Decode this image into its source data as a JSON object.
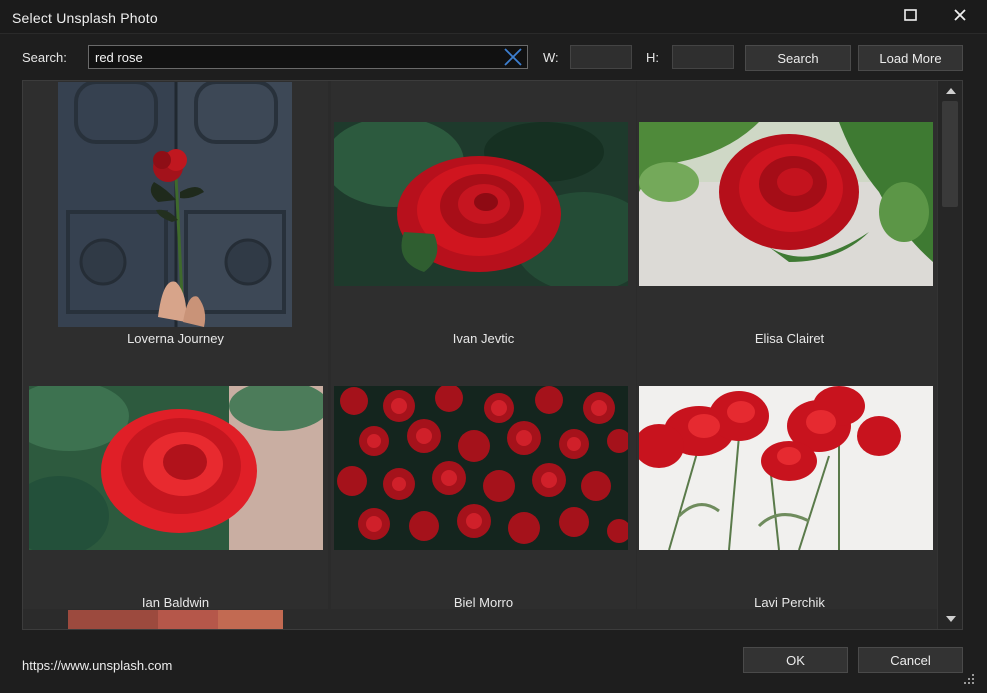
{
  "window": {
    "title": "Select Unsplash Photo"
  },
  "toolbar": {
    "search_label": "Search:",
    "search_value": "red rose",
    "w_label": "W:",
    "h_label": "H:",
    "w_value": "",
    "h_value": "",
    "search_button": "Search",
    "load_more_button": "Load More"
  },
  "photos": [
    {
      "author": "Loverna Journey"
    },
    {
      "author": "Ivan Jevtic"
    },
    {
      "author": "Elisa Clairet"
    },
    {
      "author": "Ian Baldwin"
    },
    {
      "author": "Biel Morro"
    },
    {
      "author": "Lavi Perchik"
    }
  ],
  "footer": {
    "link": "https://www.unsplash.com",
    "ok_button": "OK",
    "cancel_button": "Cancel"
  },
  "colors": {
    "accent": "#4a7fd0",
    "background": "#1e1e1e",
    "panel": "#2b2b2b"
  }
}
